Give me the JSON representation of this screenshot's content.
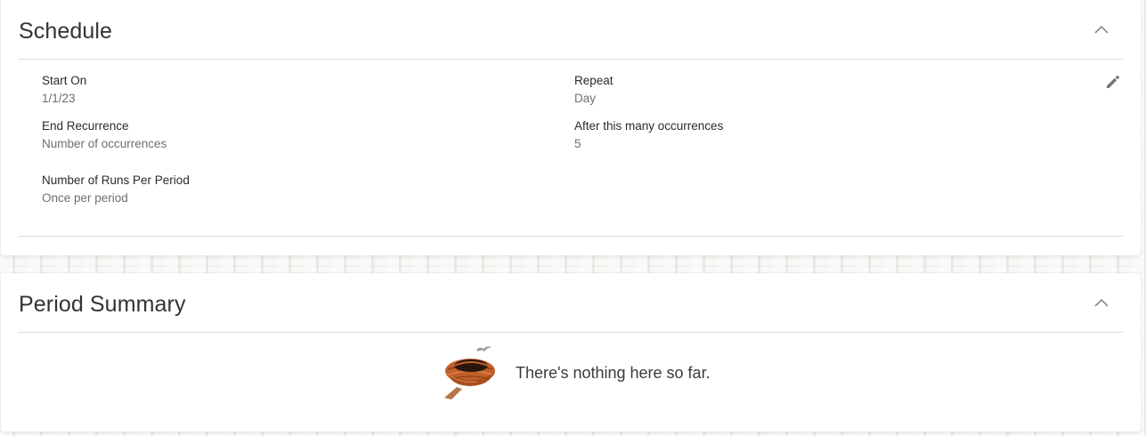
{
  "schedule": {
    "title": "Schedule",
    "collapse_icon": "chevron-up-icon",
    "edit_icon": "pencil-icon",
    "fields": {
      "start_on": {
        "label": "Start On",
        "value": "1/1/23"
      },
      "repeat": {
        "label": "Repeat",
        "value": "Day"
      },
      "end_recurrence": {
        "label": "End Recurrence",
        "value": "Number of occurrences"
      },
      "after_occurrences": {
        "label": "After this many occurrences",
        "value": "5"
      },
      "runs_per_period": {
        "label": "Number of Runs Per Period",
        "value": "Once per period"
      }
    }
  },
  "period_summary": {
    "title": "Period Summary",
    "collapse_icon": "chevron-up-icon",
    "empty_icon": "empty-nest-icon",
    "empty_message": "There's nothing here so far."
  },
  "colors": {
    "title_text": "#333333",
    "label_text": "#2b2b2b",
    "value_text": "#6f6f6f",
    "divider": "#dcdcdc",
    "nest_brown": "#b5561f"
  }
}
